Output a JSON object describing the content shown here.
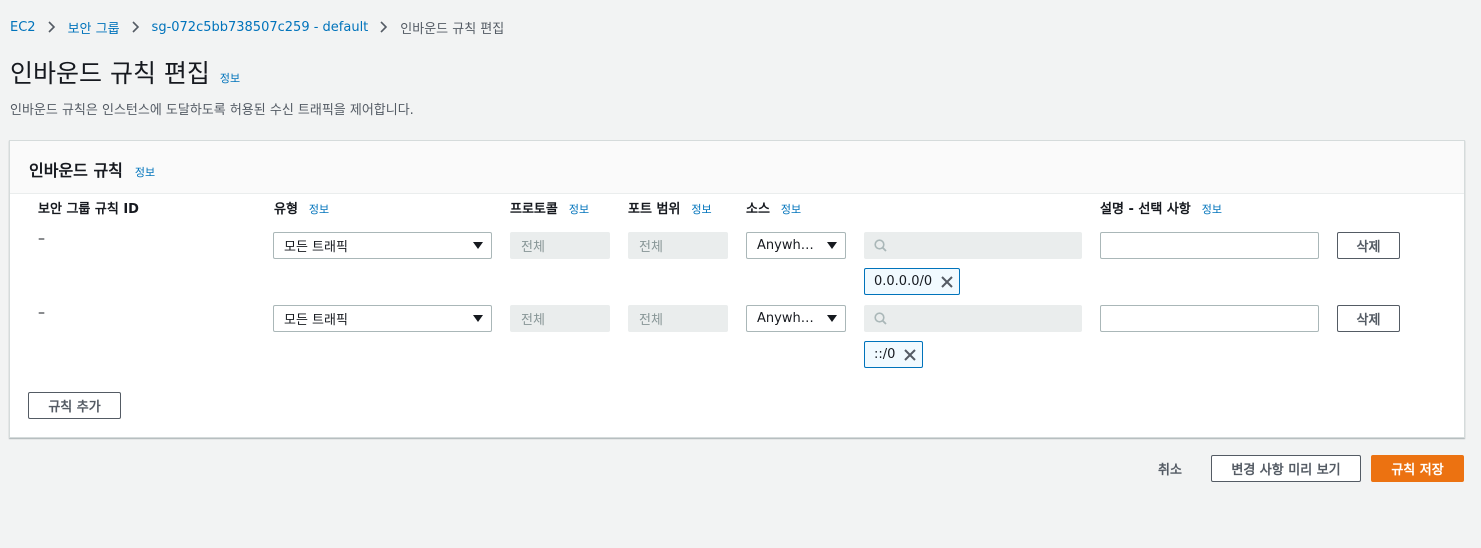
{
  "breadcrumb": {
    "items": [
      "EC2",
      "보안 그룹",
      "sg-072c5bb738507c259 - default"
    ],
    "current": "인바운드 규칙 편집"
  },
  "header": {
    "title": "인바운드 규칙 편집",
    "info": "정보",
    "description": "인바운드 규칙은 인스턴스에 도달하도록 허용된 수신 트래픽을 제어합니다."
  },
  "panel": {
    "title": "인바운드 규칙",
    "info": "정보",
    "columns": {
      "rule_id": "보안 그룹 규칙 ID",
      "type": "유형",
      "protocol": "프로토콜",
      "port_range": "포트 범위",
      "source": "소스",
      "description": "설명 - 선택 사항",
      "info": "정보"
    },
    "rows": [
      {
        "rule_id": "–",
        "type": "모든 트래픽",
        "protocol": "전체",
        "port_range": "전체",
        "source": "Anywher...",
        "token": "0.0.0.0/0",
        "description": "",
        "delete_label": "삭제"
      },
      {
        "rule_id": "–",
        "type": "모든 트래픽",
        "protocol": "전체",
        "port_range": "전체",
        "source": "Anywher...",
        "token": "::/0",
        "description": "",
        "delete_label": "삭제"
      }
    ],
    "add_rule_label": "규칙 추가"
  },
  "footer": {
    "cancel_label": "취소",
    "preview_label": "변경 사항 미리 보기",
    "save_label": "규칙 저장"
  },
  "colors": {
    "primary": "#ec7211",
    "link": "#0073bb",
    "token_border": "#0073bb",
    "background": "#f2f3f3"
  },
  "icons": [
    "chevron-right-icon",
    "caret-down-icon",
    "search-icon",
    "close-icon"
  ]
}
